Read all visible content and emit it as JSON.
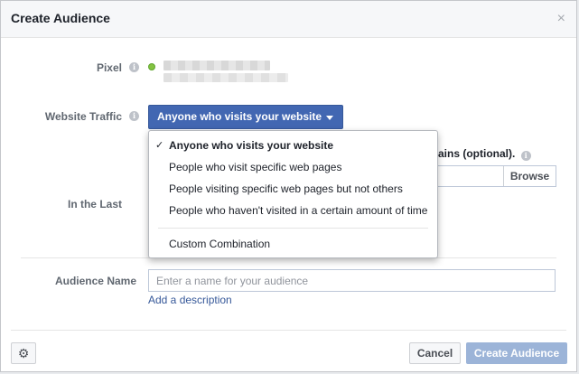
{
  "dialog": {
    "title": "Create Audience",
    "close_glyph": "×"
  },
  "pixel": {
    "label": "Pixel",
    "status_color": "#84c341"
  },
  "website_traffic": {
    "label": "Website Traffic",
    "selected": "Anyone who visits your website",
    "button_color": "#4267b2",
    "options": [
      "Anyone who visits your website",
      "People who visit specific web pages",
      "People visiting specific web pages but not others",
      "People who haven't visited in a certain amount of time",
      "Custom Combination"
    ],
    "check_glyph": "✓"
  },
  "domains": {
    "partial_label": "ains (optional).",
    "browse_label": "Browse"
  },
  "in_the_last": {
    "label": "In the Last"
  },
  "audience_name": {
    "label": "Audience Name",
    "placeholder": "Enter a name for your audience",
    "value": "",
    "add_description": "Add a description"
  },
  "footer": {
    "settings_icon": "gear-icon",
    "gear_glyph": "⚙",
    "cancel_label": "Cancel",
    "create_label": "Create Audience"
  }
}
